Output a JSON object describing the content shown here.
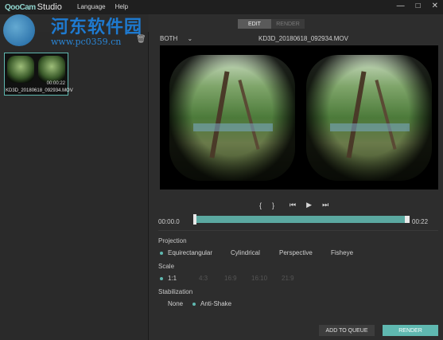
{
  "app": {
    "logo_mark": "QooCam",
    "logo_text": "Studio"
  },
  "menu": [
    "Language",
    "Help"
  ],
  "window_controls": [
    "—",
    "□",
    "✕"
  ],
  "watermark": {
    "title": "河东软件园",
    "url": "www.pc0359.cn"
  },
  "mode_tabs": {
    "edit": "EDIT",
    "render": "RENDER",
    "active": "EDIT"
  },
  "view_mode": {
    "label": "BOTH"
  },
  "file": {
    "name": "KD3D_20180618_092934.MOV"
  },
  "thumbnail": {
    "duration": "00:00:22",
    "name": "KD3D_20180618_092934.MOV"
  },
  "playback": {
    "controls": [
      "{",
      "}",
      "⏮",
      "▶",
      "⏭"
    ],
    "time_start": "00:00.0",
    "time_end": "00:22"
  },
  "projection": {
    "label": "Projection",
    "options": [
      "Equirectangular",
      "Cylindrical",
      "Perspective",
      "Fisheye"
    ],
    "selected": "Equirectangular"
  },
  "scale": {
    "label": "Scale",
    "options": [
      "1:1",
      "4:3",
      "16:9",
      "16:10",
      "21:9"
    ],
    "selected": "1:1"
  },
  "stabilization": {
    "label": "Stabilization",
    "options": [
      "None",
      "Anti-Shake"
    ],
    "selected": "Anti-Shake"
  },
  "actions": {
    "add_to_queue": "ADD TO QUEUE",
    "render": "RENDER"
  },
  "colors": {
    "accent": "#5fb8b0",
    "background": "#2b2b2b",
    "titlebar": "#1f1f1f"
  }
}
